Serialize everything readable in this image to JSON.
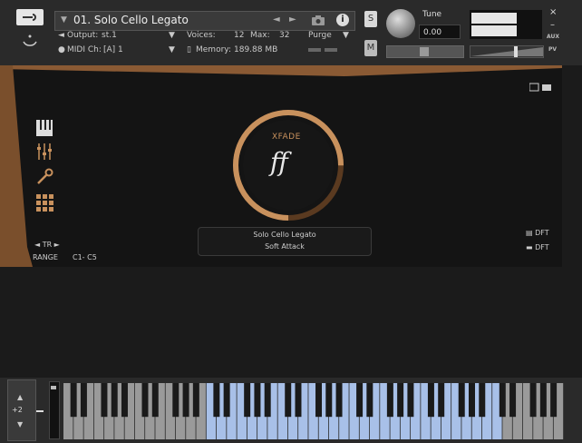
{
  "header": {
    "instrument_title": "01. Solo Cello Legato",
    "output_label": "Output:",
    "output_value": "st.1",
    "voices_label": "Voices:",
    "voices_value": "12",
    "max_label": "Max:",
    "max_value": "32",
    "purge_label": "Purge",
    "midi_label": "MIDI Ch:",
    "midi_value": "[A] 1",
    "memory_label": "Memory:",
    "memory_value": "189.88 MB",
    "solo_label": "S",
    "mute_label": "M",
    "tune_label": "Tune",
    "tune_value": "0.00",
    "close_label": "×",
    "minimize_label": "–",
    "aux_label": "AUX",
    "pv_label": "PV",
    "icons": [
      "wrench-icon",
      "collapse-icon",
      "camera-icon",
      "info-icon"
    ]
  },
  "panel": {
    "xfade_label": "XFADE",
    "dynamic_marking": "ff",
    "xfade_level": 0.75,
    "patch_name": "Solo Cello Legato",
    "articulation": "Soft Attack",
    "tr_label": "◄ TR ►",
    "range_label": "RANGE",
    "range_value": "C1-  C5",
    "dft_label_1": "DFT",
    "dft_label_2": "DFT",
    "side_icons": [
      "keys-icon",
      "mixer-icon",
      "wrench-icon",
      "grid-icon"
    ],
    "accent_color": "#c8915d",
    "wood_color": "#8a5a34"
  },
  "keyboard": {
    "octave_value": "+2",
    "octave_up": "▲",
    "octave_down": "▼",
    "active_key_color": "#a8c0e8",
    "inactive_key_color": "#9a9a9a"
  }
}
